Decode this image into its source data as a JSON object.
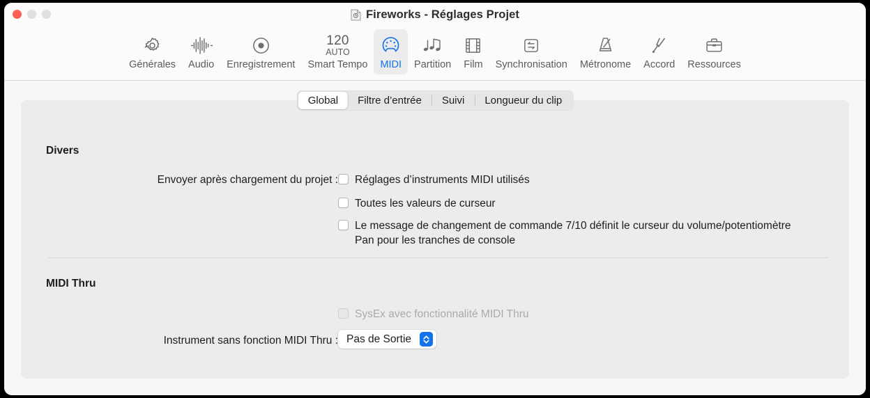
{
  "window": {
    "title": "Fireworks - Réglages Projet",
    "doc_icon": "document-icon",
    "traffic_lights": {
      "close": "close-button",
      "minimize": "minimize-button",
      "zoom": "zoom-button"
    },
    "accent_color": "#1273ec",
    "close_color": "#ff6054"
  },
  "toolbar": {
    "items": [
      {
        "label": "Générales",
        "icon": "gear-icon",
        "selected": false
      },
      {
        "label": "Audio",
        "icon": "waveform-icon",
        "selected": false
      },
      {
        "label": "Enregistrement",
        "icon": "record-icon",
        "selected": false
      },
      {
        "label": "Smart Tempo",
        "icon": "tempo-icon",
        "selected": false,
        "tempo_value": "120",
        "tempo_mode": "AUTO"
      },
      {
        "label": "MIDI",
        "icon": "midi-din-icon",
        "selected": true
      },
      {
        "label": "Partition",
        "icon": "music-notes-icon",
        "selected": false
      },
      {
        "label": "Film",
        "icon": "film-strip-icon",
        "selected": false
      },
      {
        "label": "Synchronisation",
        "icon": "sync-arrows-icon",
        "selected": false
      },
      {
        "label": "Métronome",
        "icon": "metronome-icon",
        "selected": false
      },
      {
        "label": "Accord",
        "icon": "tuning-fork-icon",
        "selected": false
      },
      {
        "label": "Ressources",
        "icon": "briefcase-icon",
        "selected": false
      }
    ]
  },
  "tabs": [
    {
      "label": "Global",
      "active": true
    },
    {
      "label": "Filtre d’entrée",
      "active": false
    },
    {
      "label": "Suivi",
      "active": false
    },
    {
      "label": "Longueur du clip",
      "active": false
    }
  ],
  "sections": {
    "divers": {
      "title": "Divers",
      "send_after_load_label": "Envoyer après chargement du projet :",
      "checkboxes": [
        {
          "label": "Réglages d’instruments MIDI utilisés",
          "checked": false,
          "disabled": false
        },
        {
          "label": "Toutes les valeurs de curseur",
          "checked": false,
          "disabled": false
        },
        {
          "label": "Le message de changement de commande 7/10 définit le curseur du volume/potentiomètre Pan pour les tranches de console",
          "checked": false,
          "disabled": false
        }
      ]
    },
    "midi_thru": {
      "title": "MIDI Thru",
      "sysex_checkbox": {
        "label": "SysEx avec fonctionnalité MIDI Thru",
        "checked": false,
        "disabled": true
      },
      "instrument_label": "Instrument sans fonction MIDI Thru :",
      "instrument_value": "Pas de Sortie"
    }
  }
}
